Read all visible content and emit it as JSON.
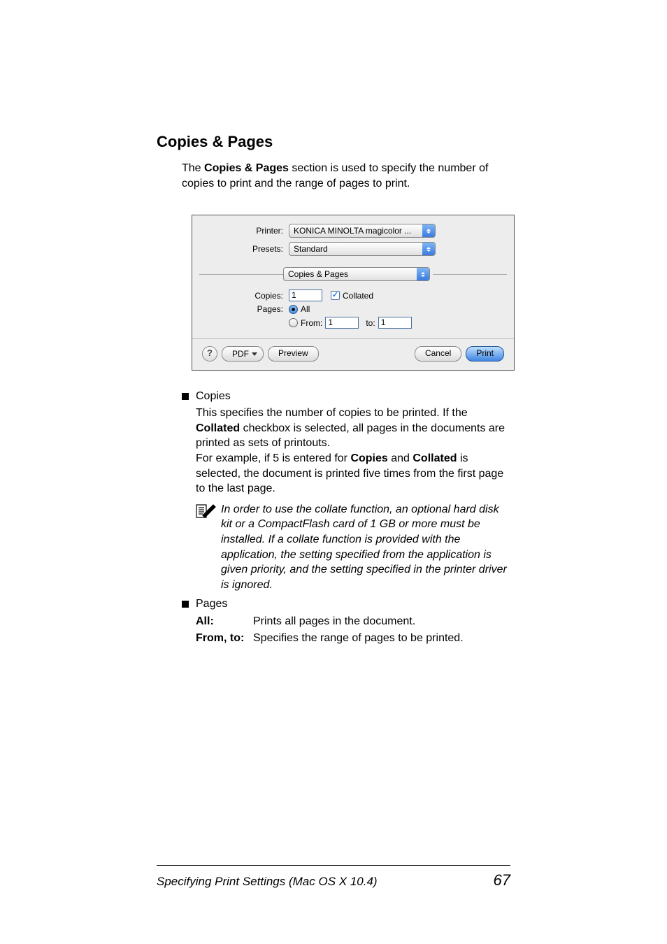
{
  "section": {
    "title": "Copies & Pages",
    "intro_parts": {
      "p1": "The ",
      "b1": "Copies & Pages",
      "p2": " section is used to specify the number of copies to print and the range of pages to print."
    }
  },
  "dialog": {
    "printer_label": "Printer:",
    "printer_value": "KONICA MINOLTA magicolor ...",
    "presets_label": "Presets:",
    "presets_value": "Standard",
    "panel_value": "Copies & Pages",
    "copies_label": "Copies:",
    "copies_value": "1",
    "collated_label": "Collated",
    "pages_label": "Pages:",
    "pages_all_label": "All",
    "pages_from_label": "From:",
    "pages_from_value": "1",
    "pages_to_label": "to:",
    "pages_to_value": "1",
    "help_label": "?",
    "pdf_label": "PDF",
    "preview_label": "Preview",
    "cancel_label": "Cancel",
    "print_label": "Print"
  },
  "bullets": {
    "copies_title": "Copies",
    "copies_body": {
      "p1": "This specifies the number of copies to be printed. If the ",
      "b1": "Collated",
      "p2": " checkbox is selected, all pages in the documents are printed as sets of printouts.",
      "p3": "For example, if 5 is entered for ",
      "b2": "Copies",
      "p4": " and ",
      "b3": "Collated",
      "p5": " is selected, the document is printed five times from the first page to the last page."
    },
    "note": "In order to use the collate function, an optional hard disk kit or a CompactFlash card of 1 GB or more must be installed. If a collate function is provided with the application, the setting specified from the application is given priority, and the setting specified in the printer driver is ignored.",
    "pages_title": "Pages",
    "pages_defs": {
      "all_term": "All",
      "all_colon": ":",
      "all_def": "Prints all pages in the document.",
      "fromto_term": "From, to",
      "fromto_colon": ":",
      "fromto_def": "Specifies the range of pages to be printed."
    }
  },
  "footer": {
    "left": "Specifying Print Settings (Mac OS X 10.4)",
    "right": "67"
  }
}
